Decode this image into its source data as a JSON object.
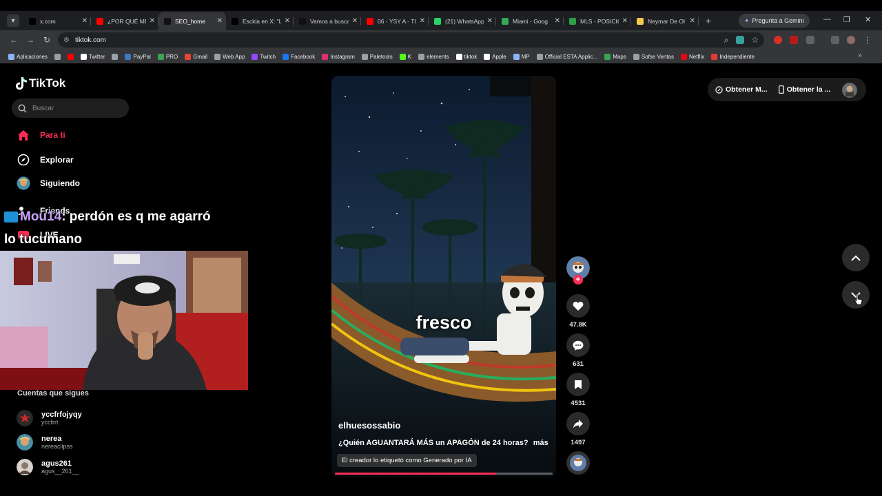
{
  "browser": {
    "tabs": [
      {
        "title": "x.com",
        "color": "#000000",
        "active": false
      },
      {
        "title": "¿POR QUÉ ME",
        "color": "#ff0000",
        "active": false
      },
      {
        "title": "SEO_home",
        "color": "#111111",
        "active": true
      },
      {
        "title": "Esckla en X: \"L",
        "color": "#000000",
        "active": false
      },
      {
        "title": "Vamos a busca",
        "color": "#111111",
        "active": false
      },
      {
        "title": "06 - YSY A - TI",
        "color": "#ff0000",
        "active": false
      },
      {
        "title": "(21) WhatsApp",
        "color": "#25d366",
        "active": false
      },
      {
        "title": "Miami - Goog",
        "color": "#34a853",
        "active": false
      },
      {
        "title": "MLS - POSICIO",
        "color": "#2e9e4a",
        "active": false
      },
      {
        "title": "Neymar De Ol",
        "color": "#f2c94c",
        "active": false
      }
    ],
    "gemini_label": "Pregunta a Gemini",
    "url": "tiktok.com",
    "bookmarks": [
      {
        "label": "Aplicaciones",
        "color": "#8ab4f8"
      },
      {
        "label": "",
        "color": "#9aa0a6"
      },
      {
        "label": "",
        "color": "#ff0000"
      },
      {
        "label": "Twitter",
        "color": "#ffffff"
      },
      {
        "label": "",
        "color": "#9aa0a6"
      },
      {
        "label": "PayPal",
        "color": "#3b7bbf"
      },
      {
        "label": "PRO",
        "color": "#34a853"
      },
      {
        "label": "Gmail",
        "color": "#ea4335"
      },
      {
        "label": "Web App",
        "color": "#9aa0a6"
      },
      {
        "label": "Twitch",
        "color": "#9146ff"
      },
      {
        "label": "Facebook",
        "color": "#1877f2"
      },
      {
        "label": "Instagram",
        "color": "#e1306c"
      },
      {
        "label": "Paletools",
        "color": "#9aa0a6"
      },
      {
        "label": "K",
        "color": "#53fc18"
      },
      {
        "label": "elements",
        "color": "#9aa0a6"
      },
      {
        "label": "tiktok",
        "color": "#ffffff"
      },
      {
        "label": "Apple",
        "color": "#ffffff"
      },
      {
        "label": "MP",
        "color": "#8ab4f8"
      },
      {
        "label": "Official ESTA Applic...",
        "color": "#9aa0a6"
      },
      {
        "label": "Maps",
        "color": "#34a853"
      },
      {
        "label": "Sofse Ventas",
        "color": "#9aa0a6"
      },
      {
        "label": "Netflix",
        "color": "#e50914"
      },
      {
        "label": "Independiente",
        "color": "#e53935"
      }
    ]
  },
  "tiktok": {
    "logo_text": "TikTok",
    "search_placeholder": "Buscar",
    "nav": {
      "para_ti": "Para ti",
      "explorar": "Explorar",
      "siguiendo": "Siguiendo",
      "friends": "Friends",
      "live": "LIVE"
    },
    "following_title": "Cuentas que sigues",
    "accounts": [
      {
        "name": "yccfrfojyqy",
        "handle": "yccfrrt"
      },
      {
        "name": "nerea",
        "handle": "nereaclipss"
      },
      {
        "name": "agus261",
        "handle": "agus__261__"
      }
    ],
    "video": {
      "caption_word": "fresco",
      "author": "elhuesossabio",
      "description": "¿Quién AGUANTARÁ MÁS un APAGÓN de 24 horas?",
      "more_label": "más",
      "ai_label": "El creador lo etiquetó como Generado por IA",
      "progress": 0.74
    },
    "actions": {
      "likes": "47.8K",
      "comments": "631",
      "saves": "4531",
      "shares": "1497"
    },
    "top_right": {
      "get_coins": "Obtener M...",
      "get_app": "Obtener la ..."
    },
    "accent_color": "#fe2c55"
  },
  "stream_overlay": {
    "chat_user": "Mou14",
    "chat_message": ": perdón es q me agarró lo tucumano"
  }
}
